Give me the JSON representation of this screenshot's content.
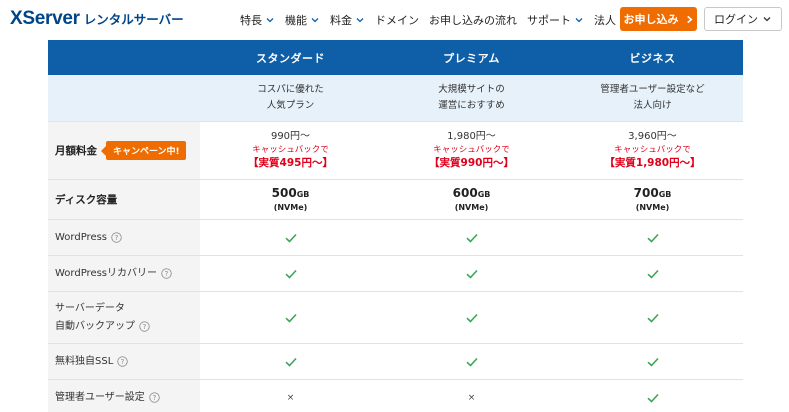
{
  "header": {
    "logo_brand": "XServer",
    "logo_sub": "レンタルサーバー",
    "nav": [
      {
        "label": "特長",
        "dropdown": true
      },
      {
        "label": "機能",
        "dropdown": true
      },
      {
        "label": "料金",
        "dropdown": true
      },
      {
        "label": "ドメイン",
        "dropdown": false
      },
      {
        "label": "お申し込みの流れ",
        "dropdown": false
      },
      {
        "label": "サポート",
        "dropdown": true
      },
      {
        "label": "法人",
        "dropdown": true
      }
    ],
    "apply_label": "お申し込み",
    "login_label": "ログイン"
  },
  "colors": {
    "brand": "#00458a",
    "header_row": "#0f5ea8",
    "accent_orange": "#ef6c00",
    "cashback_red": "#e0001a",
    "check_green": "#3aa655"
  },
  "plans": [
    {
      "name": "スタンダード",
      "desc_line1": "コスパに優れた",
      "desc_line2": "人気プラン"
    },
    {
      "name": "プレミアム",
      "desc_line1": "大規模サイトの",
      "desc_line2": "運営におすすめ"
    },
    {
      "name": "ビジネス",
      "desc_line1": "管理者ユーザー設定など",
      "desc_line2": "法人向け"
    }
  ],
  "price_row": {
    "label": "月額料金",
    "badge": "キャンペーン中!",
    "cells": [
      {
        "base": "990円～",
        "cashback": "キャッシュバックで",
        "real": "【実質495円～】"
      },
      {
        "base": "1,980円～",
        "cashback": "キャッシュバックで",
        "real": "【実質990円～】"
      },
      {
        "base": "3,960円～",
        "cashback": "キャッシュバックで",
        "real": "【実質1,980円～】"
      }
    ]
  },
  "disk_row": {
    "label": "ディスク容量",
    "cells": [
      {
        "size": "500",
        "unit": "GB",
        "type": "(NVMe)"
      },
      {
        "size": "600",
        "unit": "GB",
        "type": "(NVMe)"
      },
      {
        "size": "700",
        "unit": "GB",
        "type": "(NVMe)"
      }
    ]
  },
  "features": [
    {
      "label": "WordPress",
      "values": [
        "check",
        "check",
        "check"
      ]
    },
    {
      "label": "WordPressリカバリー",
      "values": [
        "check",
        "check",
        "check"
      ]
    },
    {
      "label_line1": "サーバーデータ",
      "label_line2": "自動バックアップ",
      "values": [
        "check",
        "check",
        "check"
      ]
    },
    {
      "label": "無料独自SSL",
      "values": [
        "check",
        "check",
        "check"
      ]
    },
    {
      "label": "管理者ユーザー設定",
      "values": [
        "×",
        "×",
        "check"
      ]
    }
  ]
}
